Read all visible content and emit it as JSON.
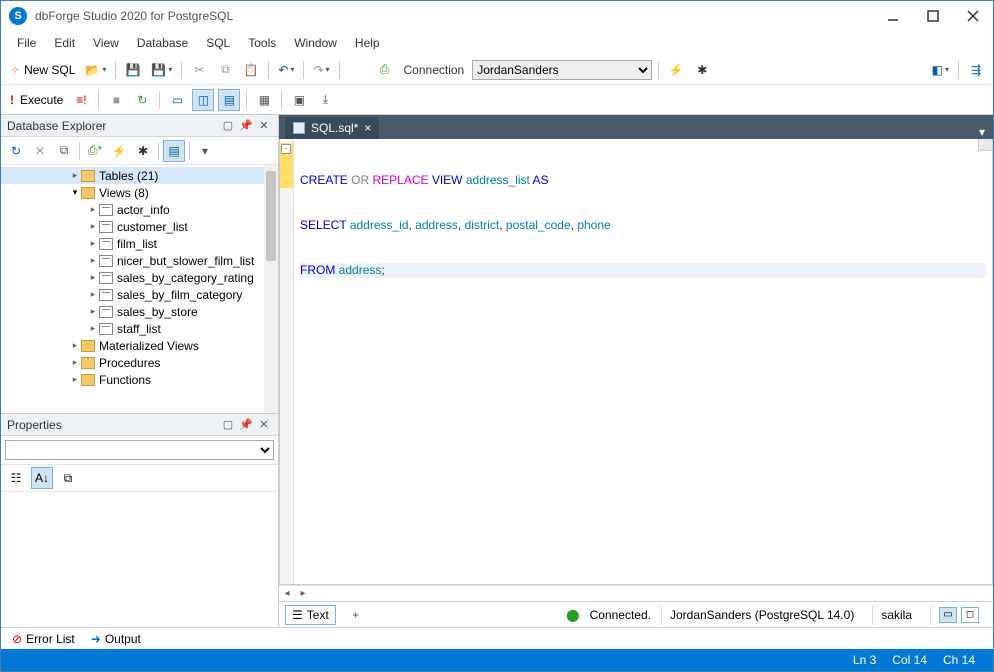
{
  "titlebar": {
    "title": "dbForge Studio 2020 for PostgreSQL",
    "logo_letter": "S"
  },
  "menu": [
    "File",
    "Edit",
    "View",
    "Database",
    "SQL",
    "Tools",
    "Window",
    "Help"
  ],
  "toolbar1": {
    "new_sql": "New SQL",
    "connection_label": "Connection",
    "connection_value": "JordanSanders"
  },
  "toolbar2": {
    "execute": "Execute"
  },
  "db_explorer": {
    "title": "Database Explorer",
    "nodes": [
      {
        "type": "folder",
        "label": "Tables (21)",
        "depth": 1,
        "open": false,
        "selected": true
      },
      {
        "type": "folder",
        "label": "Views (8)",
        "depth": 1,
        "open": true
      },
      {
        "type": "view",
        "label": "actor_info",
        "depth": 2
      },
      {
        "type": "view",
        "label": "customer_list",
        "depth": 2
      },
      {
        "type": "view",
        "label": "film_list",
        "depth": 2
      },
      {
        "type": "view",
        "label": "nicer_but_slower_film_list",
        "depth": 2
      },
      {
        "type": "view",
        "label": "sales_by_category_rating",
        "depth": 2
      },
      {
        "type": "view",
        "label": "sales_by_film_category",
        "depth": 2
      },
      {
        "type": "view",
        "label": "sales_by_store",
        "depth": 2
      },
      {
        "type": "view",
        "label": "staff_list",
        "depth": 2
      },
      {
        "type": "folder",
        "label": "Materialized Views",
        "depth": 1,
        "open": false
      },
      {
        "type": "folder",
        "label": "Procedures",
        "depth": 1,
        "open": false
      },
      {
        "type": "folder",
        "label": "Functions",
        "depth": 1,
        "open": false
      }
    ]
  },
  "properties": {
    "title": "Properties"
  },
  "document_tab": {
    "label": "SQL.sql*"
  },
  "sql": {
    "l1a": "CREATE ",
    "l1b": "OR ",
    "l1c": "REPLACE ",
    "l1d": "VIEW ",
    "l1e": "address_list ",
    "l1f": "AS",
    "l2a": "SELECT ",
    "l2b": "address_id",
    "l2c": ", ",
    "l2d": "address",
    "l2e": ", ",
    "l2f": "district",
    "l2g": ", ",
    "l2h": "postal_code",
    "l2i": ", ",
    "l2j": "phone",
    "l3a": "FROM ",
    "l3b": "address",
    "l3c": ";"
  },
  "editor_status": {
    "text_tab": "Text",
    "connected": "Connected.",
    "conn_name": "JordanSanders (PostgreSQL 14.0)",
    "db": "sakila"
  },
  "bottom_tabs": {
    "error_list": "Error List",
    "output": "Output"
  },
  "statusbar": {
    "ln": "Ln 3",
    "col": "Col 14",
    "ch": "Ch 14"
  }
}
